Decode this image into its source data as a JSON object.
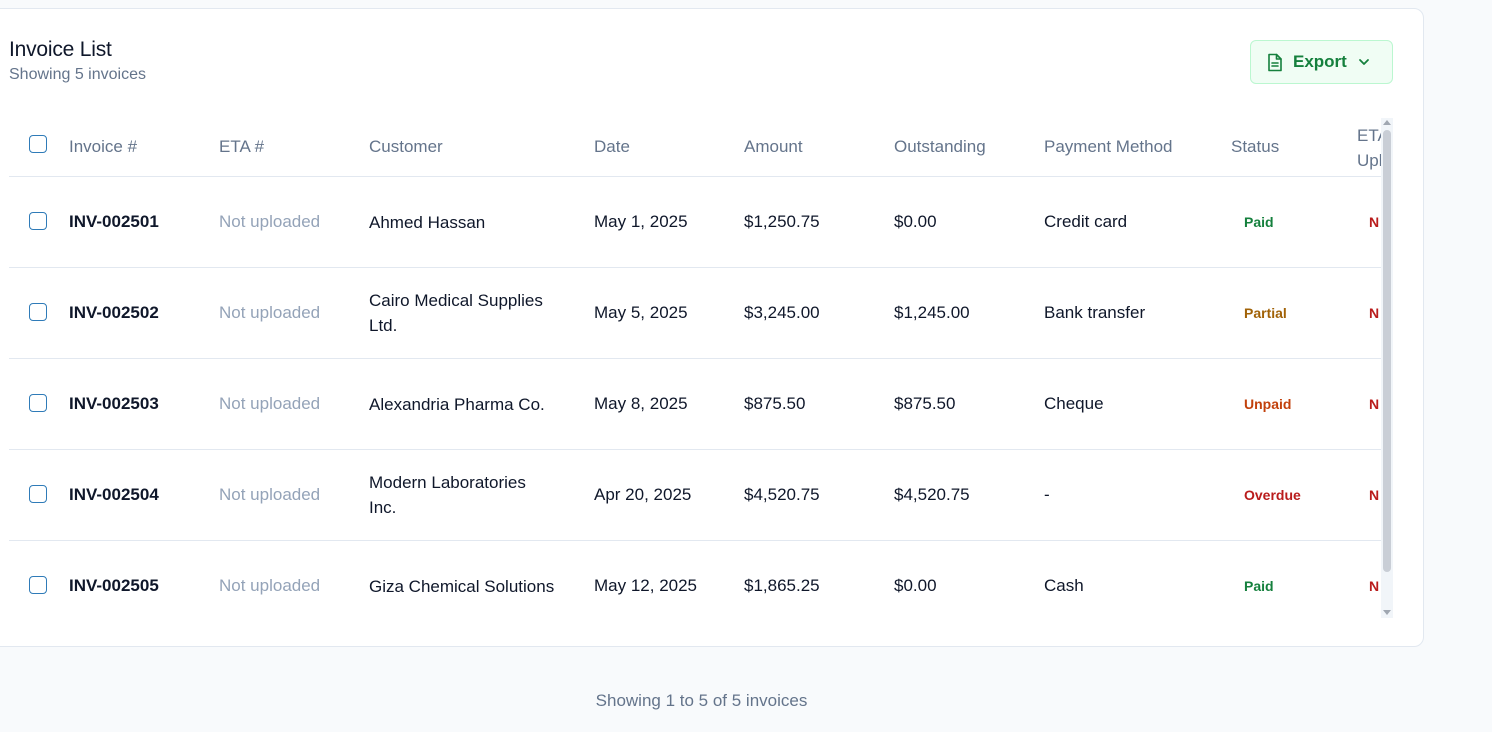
{
  "header": {
    "title": "Invoice List",
    "subtitle": "Showing 5 invoices",
    "export_label": "Export"
  },
  "table": {
    "columns": [
      "Invoice #",
      "ETA #",
      "Customer",
      "Date",
      "Amount",
      "Outstanding",
      "Payment Method",
      "Status",
      "ETA",
      "Upl"
    ],
    "rows": [
      {
        "invoice": "INV-002501",
        "eta": "Not uploaded",
        "customer": "Ahmed Hassan",
        "customer_l1": "Ahmed Hassan",
        "customer_l2": "",
        "date": "May 1, 2025",
        "amount": "$1,250.75",
        "outstanding": "$0.00",
        "payment": "Credit card",
        "status": "Paid",
        "eta_upload": "N"
      },
      {
        "invoice": "INV-002502",
        "eta": "Not uploaded",
        "customer": "Cairo Medical Supplies Ltd.",
        "customer_l1": "Cairo Medical Supplies",
        "customer_l2": "Ltd.",
        "date": "May 5, 2025",
        "amount": "$3,245.00",
        "outstanding": "$1,245.00",
        "payment": "Bank transfer",
        "status": "Partial",
        "eta_upload": "N"
      },
      {
        "invoice": "INV-002503",
        "eta": "Not uploaded",
        "customer": "Alexandria Pharma Co.",
        "customer_l1": "Alexandria Pharma Co.",
        "customer_l2": "",
        "date": "May 8, 2025",
        "amount": "$875.50",
        "outstanding": "$875.50",
        "payment": "Cheque",
        "status": "Unpaid",
        "eta_upload": "N"
      },
      {
        "invoice": "INV-002504",
        "eta": "Not uploaded",
        "customer": "Modern Laboratories Inc.",
        "customer_l1": "Modern Laboratories",
        "customer_l2": "Inc.",
        "date": "Apr 20, 2025",
        "amount": "$4,520.75",
        "outstanding": "$4,520.75",
        "payment": "-",
        "status": "Overdue",
        "eta_upload": "N"
      },
      {
        "invoice": "INV-002505",
        "eta": "Not uploaded",
        "customer": "Giza Chemical Solutions",
        "customer_l1": "Giza Chemical Solutions",
        "customer_l2": "",
        "date": "May 12, 2025",
        "amount": "$1,865.25",
        "outstanding": "$0.00",
        "payment": "Cash",
        "status": "Paid",
        "eta_upload": "N"
      }
    ]
  },
  "status_colors": {
    "Paid": "#15803d",
    "Partial": "#a16207",
    "Unpaid": "#c2410c",
    "Overdue": "#b91c1c",
    "N": "#b91c1c"
  },
  "icons": {
    "export": "document-icon",
    "export_menu": "chevron-down-icon"
  },
  "footer": {
    "pagination_text": "Showing 1 to 5 of 5 invoices"
  }
}
